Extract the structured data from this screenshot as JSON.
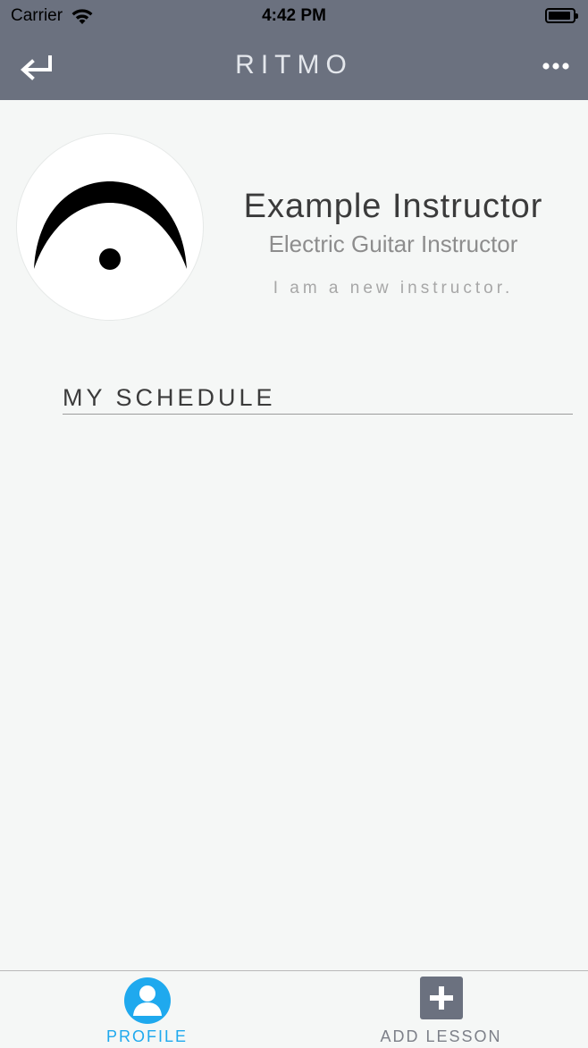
{
  "status_bar": {
    "carrier": "Carrier",
    "time": "4:42 PM"
  },
  "nav": {
    "title": "RITMO",
    "back_icon": "return-arrow-icon",
    "more_icon": "ellipsis-icon"
  },
  "profile": {
    "avatar_icon": "fermata-icon",
    "name": "Example Instructor",
    "role": "Electric Guitar Instructor",
    "bio": "I am a new instructor."
  },
  "schedule": {
    "heading": "MY SCHEDULE"
  },
  "tabs": [
    {
      "label": "PROFILE",
      "icon": "person-circle-icon",
      "active": true
    },
    {
      "label": "ADD LESSON",
      "icon": "plus-square-icon",
      "active": false
    }
  ],
  "colors": {
    "header": "#6b717f",
    "accent": "#1fa9ee",
    "background": "#f5f7f6"
  }
}
